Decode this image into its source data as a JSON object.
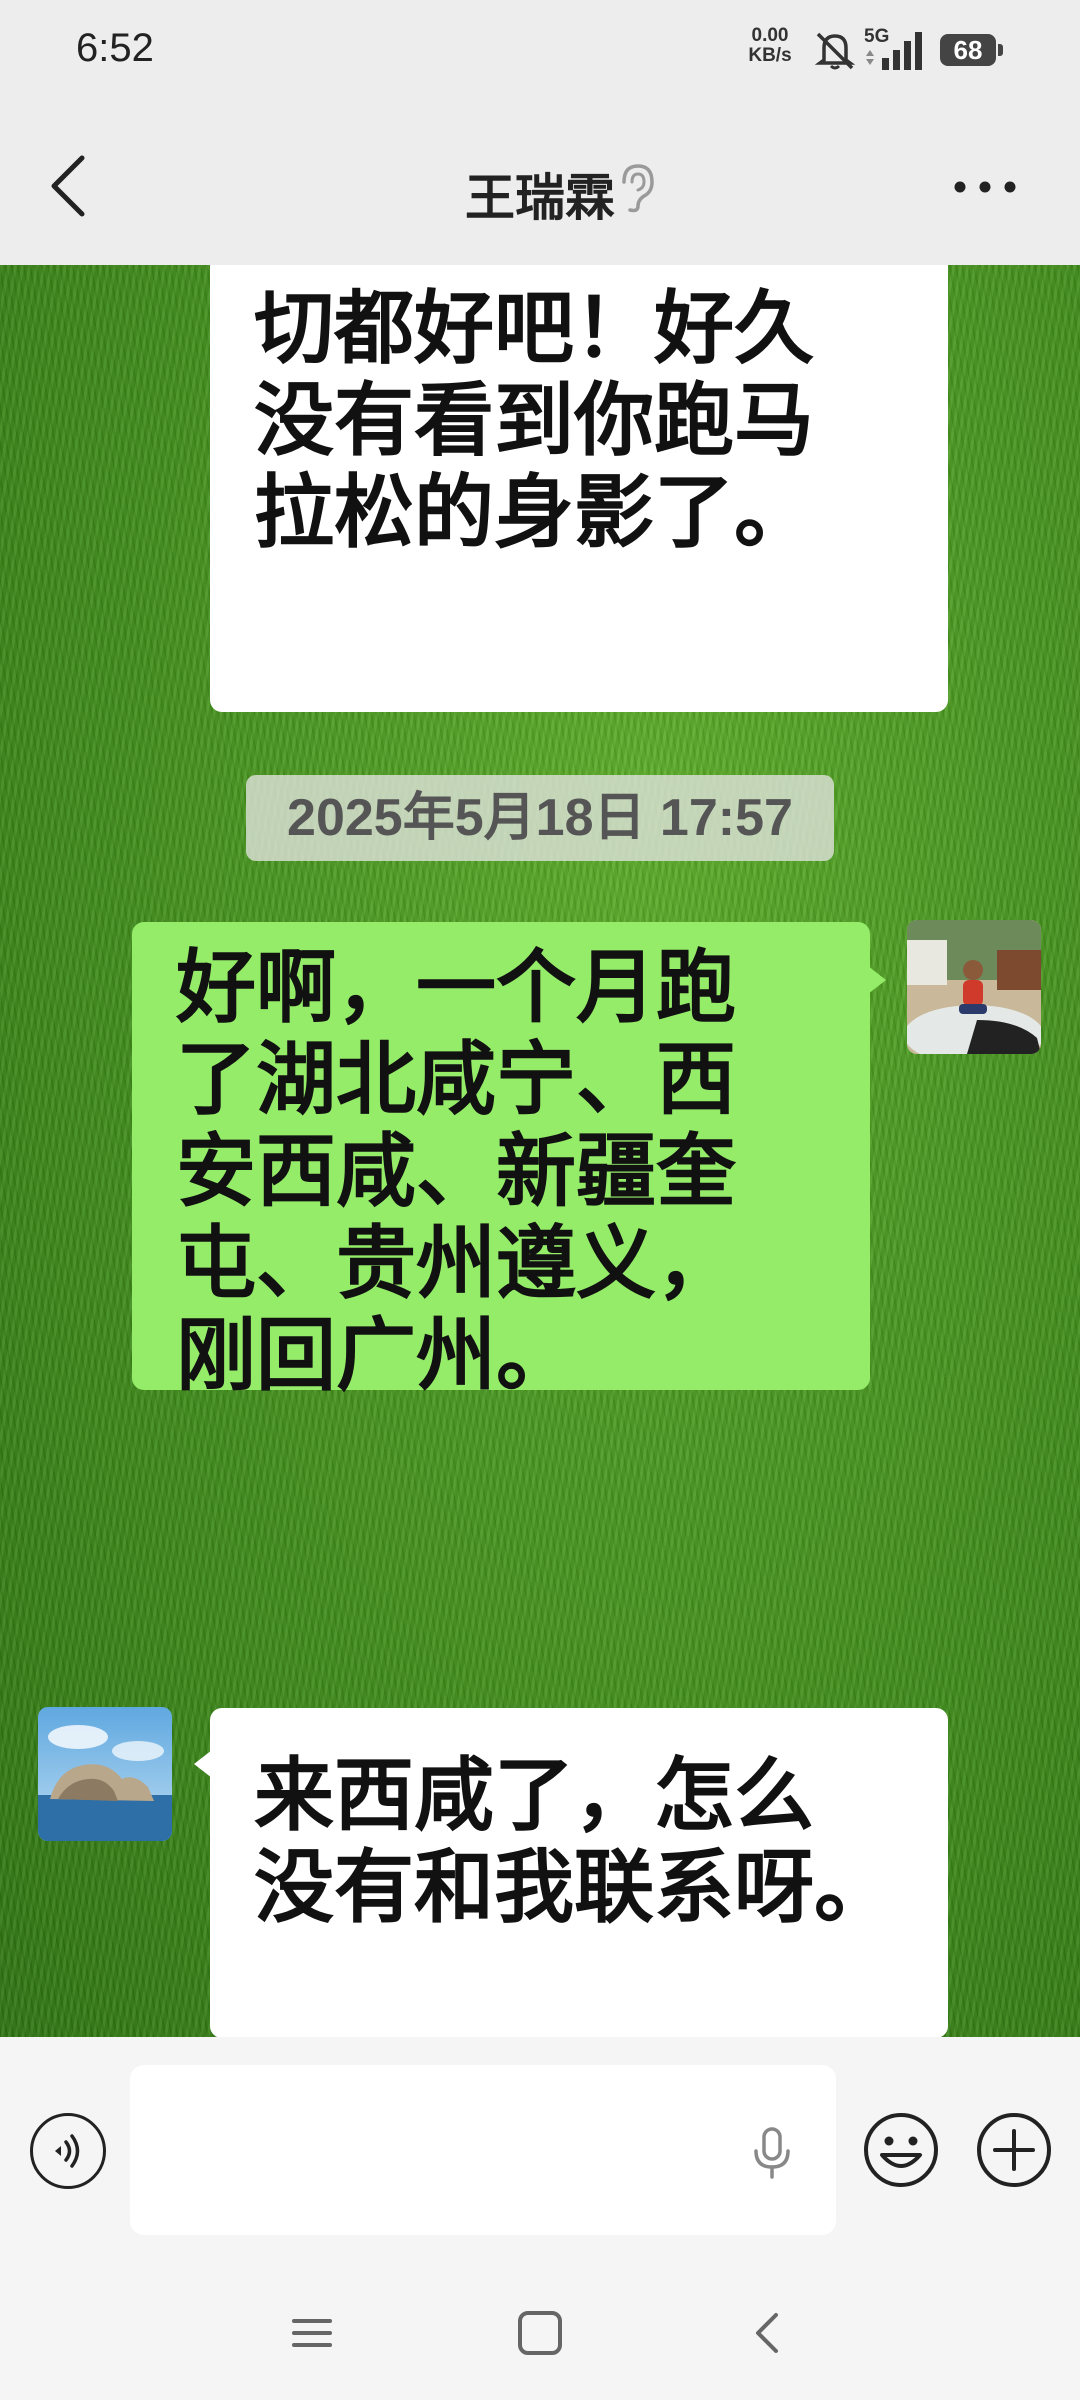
{
  "status_bar": {
    "time": "6:52",
    "net_speed_value": "0.00",
    "net_speed_unit": "KB/s",
    "network_type": "5G",
    "battery": "68"
  },
  "header": {
    "title": "王瑞霖"
  },
  "messages": [
    {
      "side": "received",
      "text": "切都好吧！好久\n没有看到你跑马\n拉松的身影了。"
    },
    {
      "side": "sent",
      "text": "好啊，一个月跑\n了湖北咸宁、西\n安西咸、新疆奎\n屯、贵州遵义，\n刚回广州。"
    },
    {
      "side": "received",
      "text": "来西咸了，怎么\n没有和我联系呀。"
    }
  ],
  "timestamp": "2025年5月18日 17:57",
  "input": {
    "value": "",
    "placeholder": ""
  },
  "colors": {
    "sent_bubble": "#95ec69",
    "received_bubble": "#ffffff",
    "bar_background": "#ededed"
  },
  "icons": [
    "back-arrow-icon",
    "ear-icon",
    "more-icon",
    "voice-icon",
    "mic-icon",
    "emoji-icon",
    "plus-icon",
    "menu-nav-icon",
    "home-nav-icon",
    "back-nav-icon"
  ]
}
